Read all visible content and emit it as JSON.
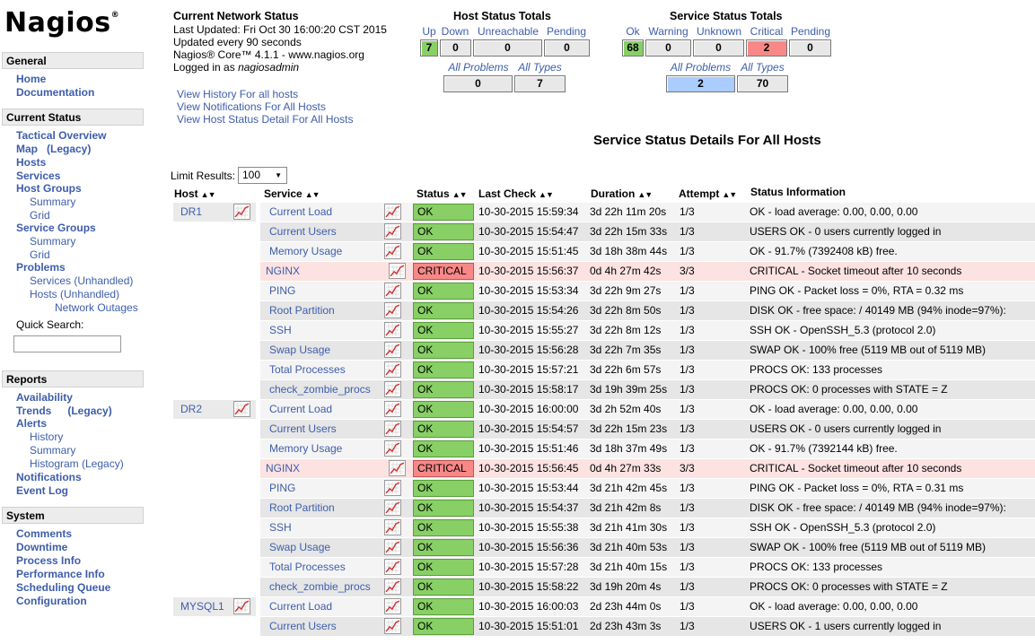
{
  "logo": {
    "text": "Nagios",
    "mark": "®"
  },
  "sidebar": {
    "general": {
      "title": "General",
      "items": [
        "Home",
        "Documentation"
      ]
    },
    "current_status": {
      "title": "Current Status",
      "tactical_overview": "Tactical Overview",
      "map": "Map",
      "map_legacy": "(Legacy)",
      "hosts": "Hosts",
      "services": "Services",
      "host_groups": "Host Groups",
      "hg_summary": "Summary",
      "hg_grid": "Grid",
      "service_groups": "Service Groups",
      "sg_summary": "Summary",
      "sg_grid": "Grid",
      "problems": "Problems",
      "prob_services": "Services (Unhandled)",
      "prob_hosts": "Hosts (Unhandled)",
      "prob_outages": "Network Outages",
      "quick_search": "Quick Search:"
    },
    "reports": {
      "title": "Reports",
      "availability": "Availability",
      "trends": "Trends",
      "trends_legacy": "(Legacy)",
      "alerts": "Alerts",
      "history": "History",
      "summary": "Summary",
      "histogram": "Histogram (Legacy)",
      "notifications": "Notifications",
      "event_log": "Event Log"
    },
    "system": {
      "title": "System",
      "items": [
        "Comments",
        "Downtime",
        "Process Info",
        "Performance Info",
        "Scheduling Queue",
        "Configuration"
      ]
    }
  },
  "header": {
    "title": "Current Network Status",
    "last_updated": "Last Updated: Fri Oct 30 16:00:20 CST 2015",
    "update_interval": "Updated every 90 seconds",
    "version": "Nagios® Core™ 4.1.1 - www.nagios.org",
    "logged_in_prefix": "Logged in as ",
    "user": "nagiosadmin",
    "links": [
      "View History For all hosts",
      "View Notifications For All Hosts",
      "View Host Status Detail For All Hosts"
    ]
  },
  "host_totals": {
    "title": "Host Status Totals",
    "labels": [
      "Up",
      "Down",
      "Unreachable",
      "Pending"
    ],
    "values": [
      "7",
      "0",
      "0",
      "0"
    ],
    "all_labels": [
      "All Problems",
      "All Types"
    ],
    "all_values": [
      "0",
      "7"
    ]
  },
  "service_totals": {
    "title": "Service Status Totals",
    "labels": [
      "Ok",
      "Warning",
      "Unknown",
      "Critical",
      "Pending"
    ],
    "values": [
      "68",
      "0",
      "0",
      "2",
      "0"
    ],
    "all_labels": [
      "All Problems",
      "All Types"
    ],
    "all_values": [
      "2",
      "70"
    ]
  },
  "details": {
    "title": "Service Status Details For All Hosts",
    "limit_label": "Limit Results:",
    "limit_value": "100",
    "columns": [
      "Host",
      "Service",
      "Status",
      "Last Check",
      "Duration",
      "Attempt",
      "Status Information"
    ]
  },
  "colors": {
    "ok": "#88d066",
    "critical": "#f88888",
    "link": "#3d5dab"
  },
  "rows": [
    {
      "host": "DR1",
      "service": "Current Load",
      "status": "OK",
      "last_check": "10-30-2015 15:59:34",
      "duration": "3d 22h 11m 20s",
      "attempt": "1/3",
      "info": "OK - load average: 0.00, 0.00, 0.00"
    },
    {
      "host": "",
      "service": "Current Users",
      "status": "OK",
      "last_check": "10-30-2015 15:54:47",
      "duration": "3d 22h 15m 33s",
      "attempt": "1/3",
      "info": "USERS OK - 0 users currently logged in"
    },
    {
      "host": "",
      "service": "Memory Usage",
      "status": "OK",
      "last_check": "10-30-2015 15:51:45",
      "duration": "3d 18h 38m 44s",
      "attempt": "1/3",
      "info": "OK - 91.7% (7392408 kB) free."
    },
    {
      "host": "",
      "service": "NGINX",
      "status": "CRITICAL",
      "last_check": "10-30-2015 15:56:37",
      "duration": "0d 4h 27m 42s",
      "attempt": "3/3",
      "info": "CRITICAL - Socket timeout after 10 seconds"
    },
    {
      "host": "",
      "service": "PING",
      "status": "OK",
      "last_check": "10-30-2015 15:53:34",
      "duration": "3d 22h 9m 27s",
      "attempt": "1/3",
      "info": "PING OK - Packet loss = 0%, RTA = 0.32 ms"
    },
    {
      "host": "",
      "service": "Root Partition",
      "status": "OK",
      "last_check": "10-30-2015 15:54:26",
      "duration": "3d 22h 8m 50s",
      "attempt": "1/3",
      "info": "DISK OK - free space: / 40149 MB (94% inode=97%):"
    },
    {
      "host": "",
      "service": "SSH",
      "status": "OK",
      "last_check": "10-30-2015 15:55:27",
      "duration": "3d 22h 8m 12s",
      "attempt": "1/3",
      "info": "SSH OK - OpenSSH_5.3 (protocol 2.0)"
    },
    {
      "host": "",
      "service": "Swap Usage",
      "status": "OK",
      "last_check": "10-30-2015 15:56:28",
      "duration": "3d 22h 7m 35s",
      "attempt": "1/3",
      "info": "SWAP OK - 100% free (5119 MB out of 5119 MB)"
    },
    {
      "host": "",
      "service": "Total Processes",
      "status": "OK",
      "last_check": "10-30-2015 15:57:21",
      "duration": "3d 22h 6m 57s",
      "attempt": "1/3",
      "info": "PROCS OK: 133 processes"
    },
    {
      "host": "",
      "service": "check_zombie_procs",
      "status": "OK",
      "last_check": "10-30-2015 15:58:17",
      "duration": "3d 19h 39m 25s",
      "attempt": "1/3",
      "info": "PROCS OK: 0 processes with STATE = Z"
    },
    {
      "host": "DR2",
      "service": "Current Load",
      "status": "OK",
      "last_check": "10-30-2015 16:00:00",
      "duration": "3d 2h 52m 40s",
      "attempt": "1/3",
      "info": "OK - load average: 0.00, 0.00, 0.00"
    },
    {
      "host": "",
      "service": "Current Users",
      "status": "OK",
      "last_check": "10-30-2015 15:54:57",
      "duration": "3d 22h 15m 23s",
      "attempt": "1/3",
      "info": "USERS OK - 0 users currently logged in"
    },
    {
      "host": "",
      "service": "Memory Usage",
      "status": "OK",
      "last_check": "10-30-2015 15:51:46",
      "duration": "3d 18h 37m 49s",
      "attempt": "1/3",
      "info": "OK - 91.7% (7392144 kB) free."
    },
    {
      "host": "",
      "service": "NGINX",
      "status": "CRITICAL",
      "last_check": "10-30-2015 15:56:45",
      "duration": "0d 4h 27m 33s",
      "attempt": "3/3",
      "info": "CRITICAL - Socket timeout after 10 seconds"
    },
    {
      "host": "",
      "service": "PING",
      "status": "OK",
      "last_check": "10-30-2015 15:53:44",
      "duration": "3d 21h 42m 45s",
      "attempt": "1/3",
      "info": "PING OK - Packet loss = 0%, RTA = 0.31 ms"
    },
    {
      "host": "",
      "service": "Root Partition",
      "status": "OK",
      "last_check": "10-30-2015 15:54:37",
      "duration": "3d 21h 42m 8s",
      "attempt": "1/3",
      "info": "DISK OK - free space: / 40149 MB (94% inode=97%):"
    },
    {
      "host": "",
      "service": "SSH",
      "status": "OK",
      "last_check": "10-30-2015 15:55:38",
      "duration": "3d 21h 41m 30s",
      "attempt": "1/3",
      "info": "SSH OK - OpenSSH_5.3 (protocol 2.0)"
    },
    {
      "host": "",
      "service": "Swap Usage",
      "status": "OK",
      "last_check": "10-30-2015 15:56:36",
      "duration": "3d 21h 40m 53s",
      "attempt": "1/3",
      "info": "SWAP OK - 100% free (5119 MB out of 5119 MB)"
    },
    {
      "host": "",
      "service": "Total Processes",
      "status": "OK",
      "last_check": "10-30-2015 15:57:28",
      "duration": "3d 21h 40m 15s",
      "attempt": "1/3",
      "info": "PROCS OK: 133 processes"
    },
    {
      "host": "",
      "service": "check_zombie_procs",
      "status": "OK",
      "last_check": "10-30-2015 15:58:22",
      "duration": "3d 19h 20m 4s",
      "attempt": "1/3",
      "info": "PROCS OK: 0 processes with STATE = Z"
    },
    {
      "host": "MYSQL1",
      "service": "Current Load",
      "status": "OK",
      "last_check": "10-30-2015 16:00:03",
      "duration": "2d 23h 44m 0s",
      "attempt": "1/3",
      "info": "OK - load average: 0.00, 0.00, 0.00"
    },
    {
      "host": "",
      "service": "Current Users",
      "status": "OK",
      "last_check": "10-30-2015 15:51:01",
      "duration": "2d 23h 43m 3s",
      "attempt": "1/3",
      "info": "USERS OK - 1 users currently logged in"
    }
  ]
}
